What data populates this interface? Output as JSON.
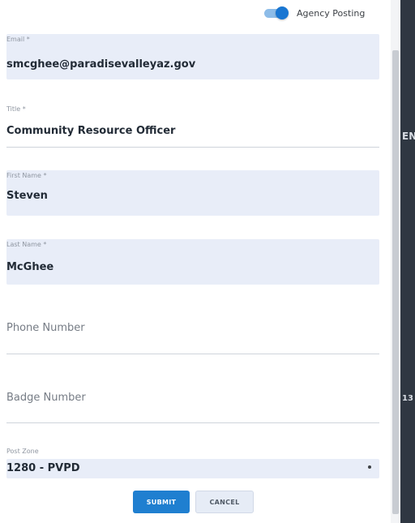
{
  "header": {
    "agency_posting_label": "Agency Posting",
    "agency_posting_enabled": true
  },
  "form": {
    "fields": [
      {
        "label": "Email *",
        "value": "smcghee@paradisevalleyaz.gov"
      },
      {
        "label": "Title *",
        "value": "Community Resource Officer"
      },
      {
        "label": "First Name *",
        "value": "Steven"
      },
      {
        "label": "Last Name *",
        "value": "McGhee"
      },
      {
        "label": "",
        "placeholder": "Phone Number",
        "value": ""
      },
      {
        "label": "",
        "placeholder": "Badge Number",
        "value": ""
      },
      {
        "label": "Post Zone",
        "value": "1280 - PVPD"
      }
    ],
    "submit_label": "SUBMIT",
    "cancel_label": "CANCEL"
  },
  "background": {
    "partial_text_1": "EN",
    "partial_text_2": "13"
  },
  "colors": {
    "primary": "#1f7fd0",
    "toggle_track": "#8dbce8",
    "toggle_knob": "#1976d2",
    "filled_field": "#e8edf8"
  },
  "icons": {
    "post_zone_dropdown": "dropdown-indicator-icon"
  }
}
